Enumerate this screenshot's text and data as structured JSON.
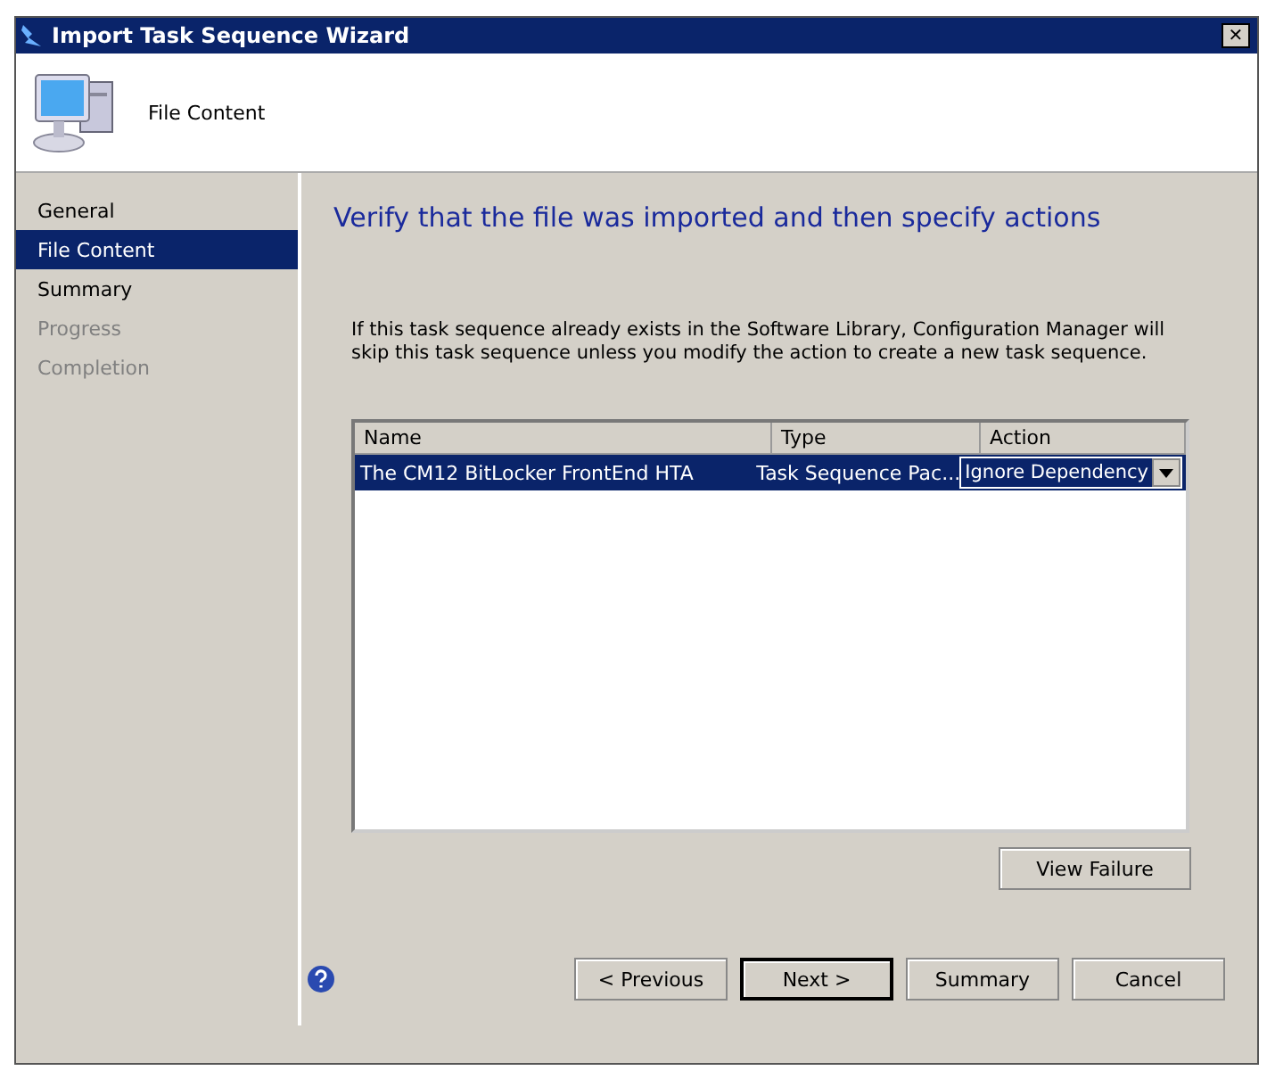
{
  "window": {
    "title": "Import Task Sequence Wizard",
    "close": "✕"
  },
  "header": {
    "title": "File Content"
  },
  "sidebar": {
    "items": [
      {
        "label": "General",
        "selected": false,
        "disabled": false
      },
      {
        "label": "File Content",
        "selected": true,
        "disabled": false
      },
      {
        "label": "Summary",
        "selected": false,
        "disabled": false
      },
      {
        "label": "Progress",
        "selected": false,
        "disabled": true
      },
      {
        "label": "Completion",
        "selected": false,
        "disabled": true
      }
    ]
  },
  "page": {
    "heading": "Verify that the file was imported and then specify actions",
    "description": "If this task sequence already exists in the Software Library, Configuration Manager will skip this task sequence unless you modify the action to create a new task sequence."
  },
  "table": {
    "columns": [
      "Name",
      "Type",
      "Action"
    ],
    "rows": [
      {
        "name": "The CM12 BitLocker FrontEnd HTA",
        "type": "Task Sequence Pac...",
        "action": "Ignore Dependency",
        "selected": true
      }
    ]
  },
  "view_failure_button": "View Failure",
  "footer": {
    "buttons": [
      {
        "label": "< Previous",
        "default": false
      },
      {
        "label": "Next >",
        "default": true
      },
      {
        "label": "Summary",
        "default": false
      },
      {
        "label": "Cancel",
        "default": false
      }
    ]
  }
}
